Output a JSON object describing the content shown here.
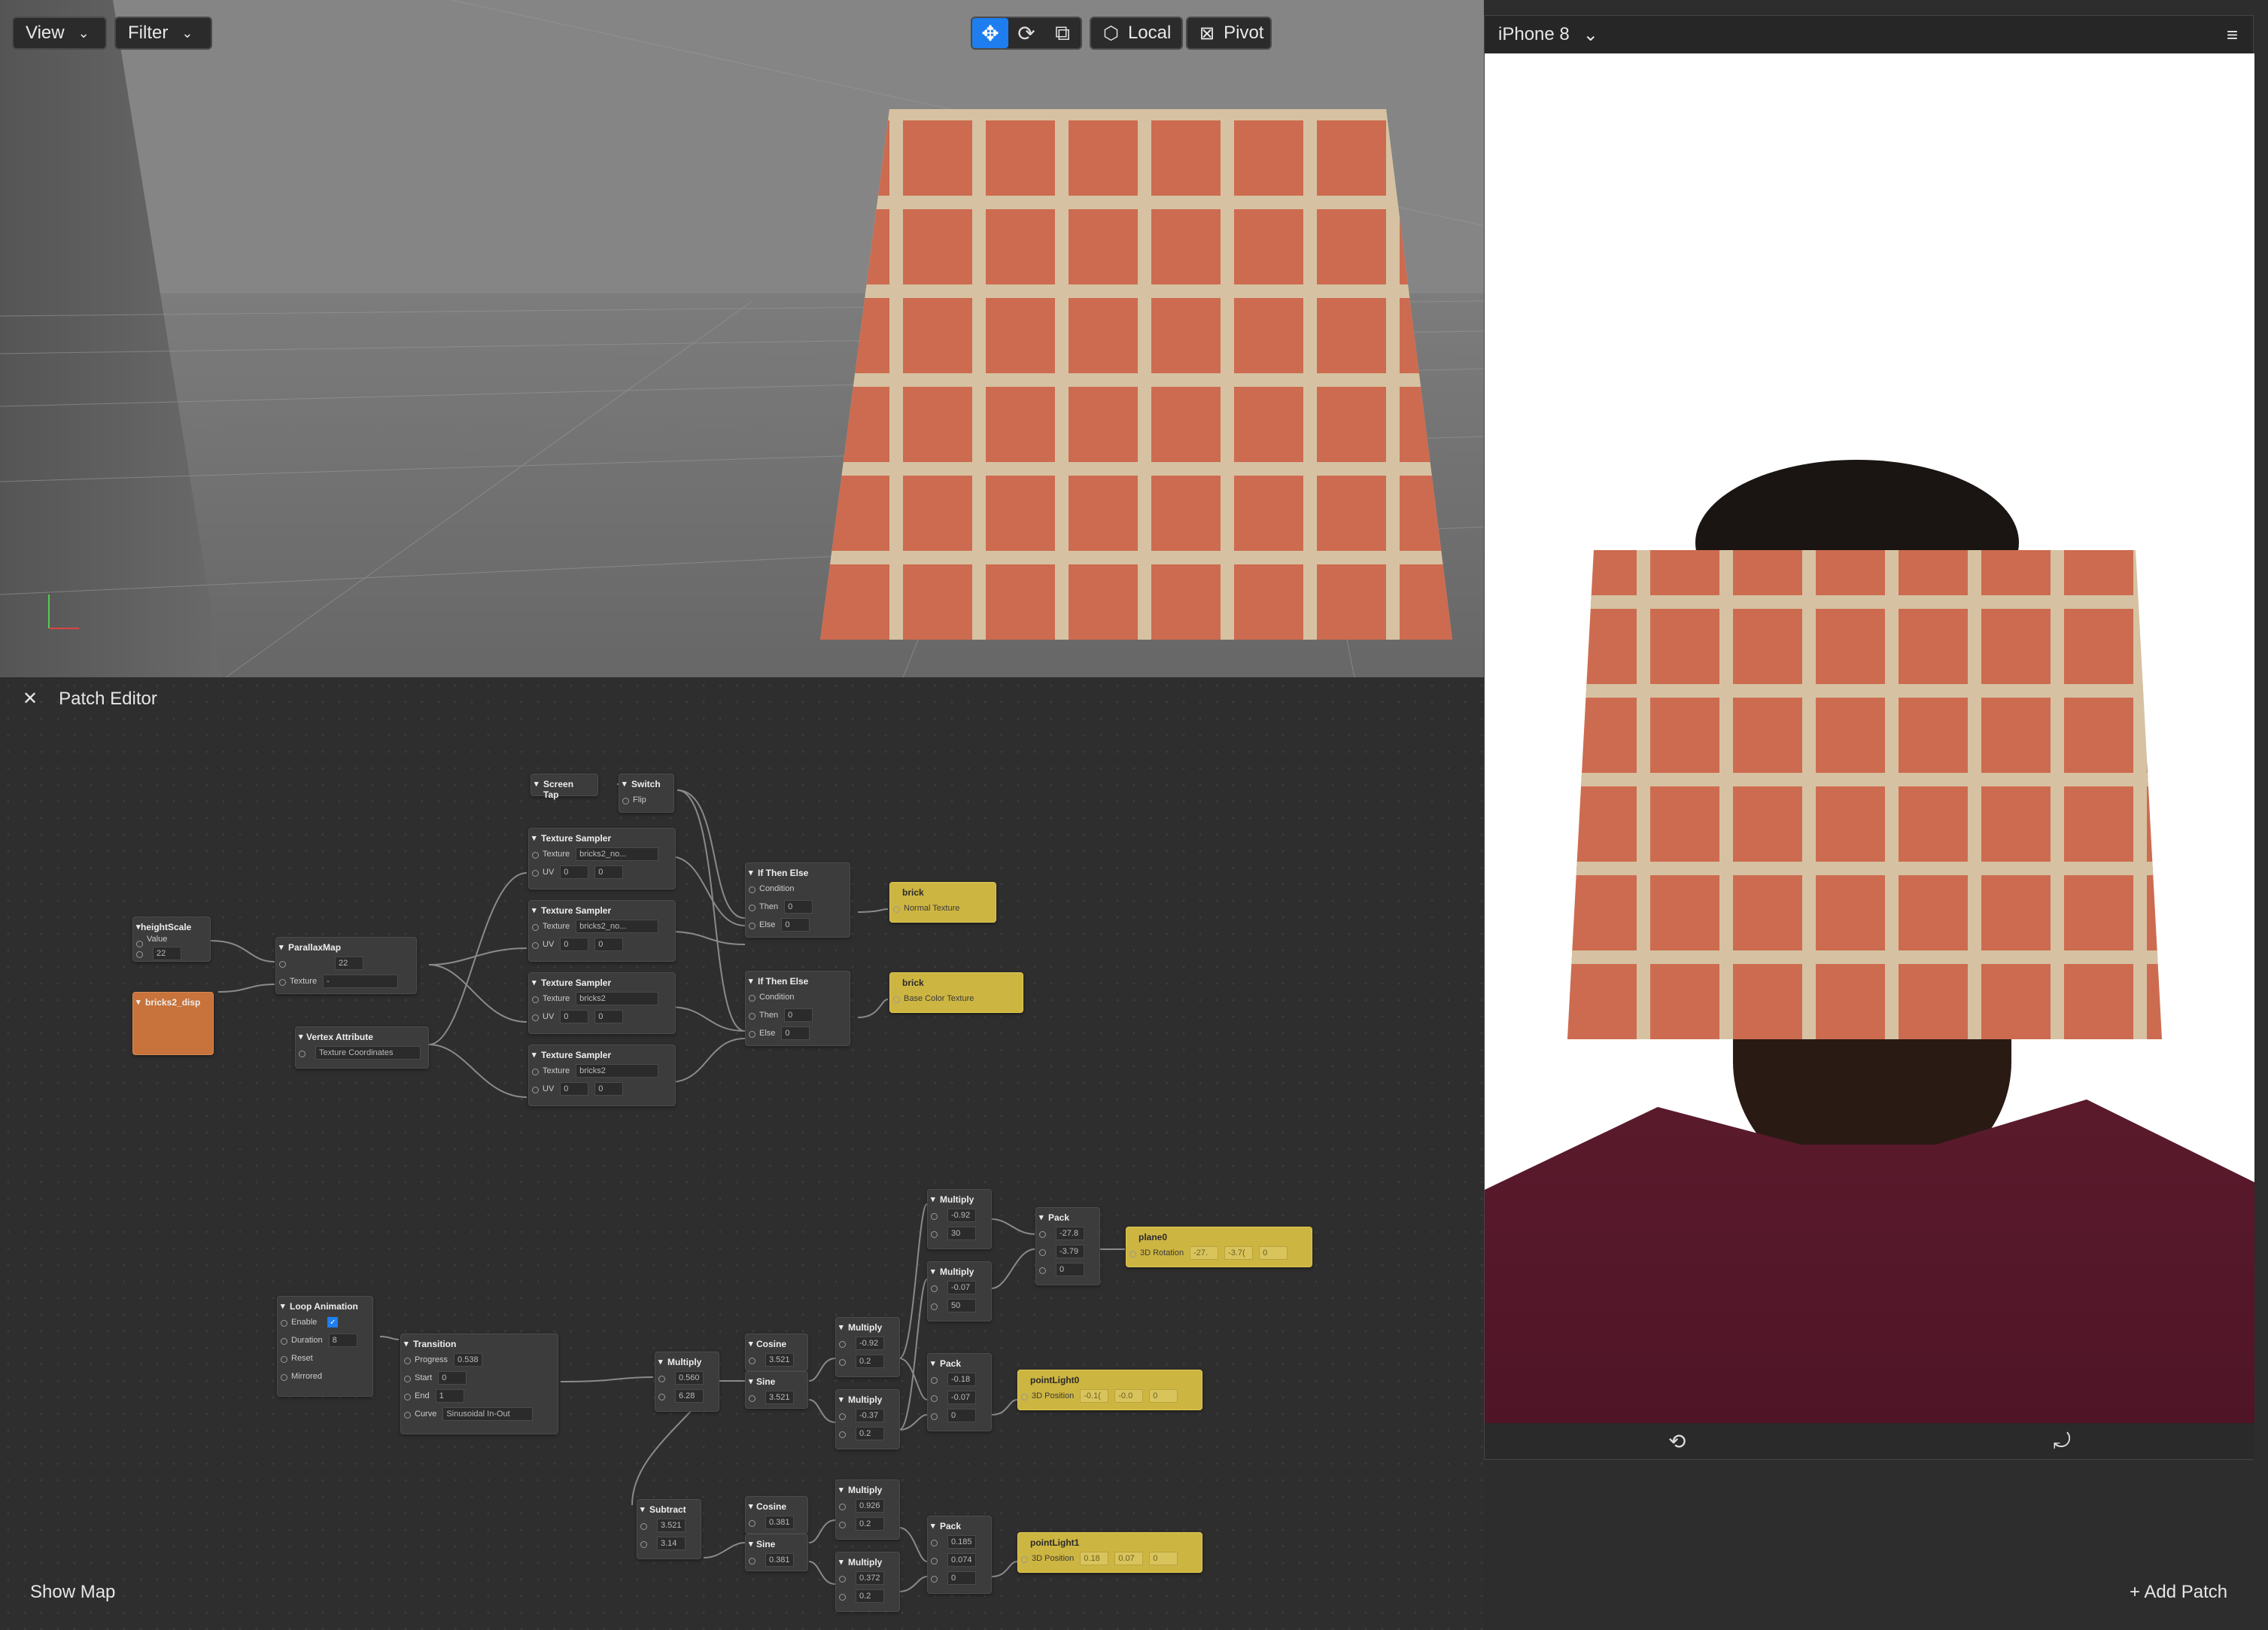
{
  "viewport_toolbar": {
    "view": "View",
    "filter": "Filter",
    "local": "Local",
    "pivot": "Pivot"
  },
  "patch_editor": {
    "title": "Patch Editor",
    "show_map": "Show Map",
    "add_patch": "Add Patch"
  },
  "simulator": {
    "device": "iPhone 8"
  },
  "nodes": {
    "screen_tap": "Screen Tap",
    "switch": {
      "title": "Switch",
      "flip": "Flip"
    },
    "texture_sampler": "Texture Sampler",
    "texture_label": "Texture",
    "uv_label": "UV",
    "ts1_tex": "bricks2_no...",
    "ts2_tex": "bricks2_no...",
    "ts3_tex": "bricks2",
    "ts4_tex": "bricks2",
    "zero": "0",
    "if_then_else": "If Then Else",
    "condition": "Condition",
    "then": "Then",
    "else": "Else",
    "brick1": {
      "title": "brick",
      "port": "Normal Texture"
    },
    "brick2": {
      "title": "brick",
      "port": "Base Color Texture"
    },
    "height_scale": {
      "title": "heightScale",
      "sub": "Value",
      "value": "22"
    },
    "parallax": {
      "title": "ParallaxMap",
      "value": "22",
      "texture": "Texture",
      "texval": "-"
    },
    "bricks_disp": "bricks2_disp",
    "vertex_attr": {
      "title": "Vertex Attribute",
      "value": "Texture Coordinates"
    },
    "loop": {
      "title": "Loop Animation",
      "enable": "Enable",
      "duration": "Duration",
      "duration_val": "8",
      "reset": "Reset",
      "mirrored": "Mirrored"
    },
    "transition": {
      "title": "Transition",
      "progress": "Progress",
      "progress_val": "0.538",
      "start": "Start",
      "start_val": "0",
      "end": "End",
      "end_val": "1",
      "curve": "Curve",
      "curve_val": "Sinusoidal In-Out"
    },
    "mult_a": {
      "title": "Multiply",
      "v1": "0.560",
      "v2": "6.28"
    },
    "cosine": "Cosine",
    "sine": "Sine",
    "cos_val1": "3.521",
    "sin_val1": "3.521",
    "mult_b": {
      "title": "Multiply",
      "v1": "-0.92",
      "v2": "0.2"
    },
    "mult_c": {
      "title": "Multiply",
      "v1": "-0.37",
      "v2": "0.2"
    },
    "mult_top1": {
      "title": "Multiply",
      "v1": "-0.92",
      "v2": "30"
    },
    "mult_top2": {
      "title": "Multiply",
      "v1": "-0.07",
      "v2": "50"
    },
    "pack1": {
      "title": "Pack",
      "v1": "-27.8",
      "v2": "-3.79",
      "v3": "0"
    },
    "plane0": {
      "title": "plane0",
      "port": "3D Rotation",
      "v1": "-27.",
      "v2": "-3.7(",
      "v3": "0"
    },
    "pack2": {
      "title": "Pack",
      "v1": "-0.18",
      "v2": "-0.07",
      "v3": "0"
    },
    "pointlight0": {
      "title": "pointLight0",
      "port": "3D Position",
      "v1": "-0.1(",
      "v2": "-0.0",
      "v3": "0"
    },
    "subtract": {
      "title": "Subtract",
      "v1": "3.521",
      "v2": "3.14"
    },
    "cos_val2": "0.381",
    "sin_val2": "0.381",
    "mult_d": {
      "title": "Multiply",
      "v1": "0.926",
      "v2": "0.2"
    },
    "mult_e": {
      "title": "Multiply",
      "v1": "0.372",
      "v2": "0.2"
    },
    "pack3": {
      "title": "Pack",
      "v1": "0.185",
      "v2": "0.074",
      "v3": "0"
    },
    "pointlight1": {
      "title": "pointLight1",
      "port": "3D Position",
      "v1": "0.18",
      "v2": "0.07",
      "v3": "0"
    }
  }
}
